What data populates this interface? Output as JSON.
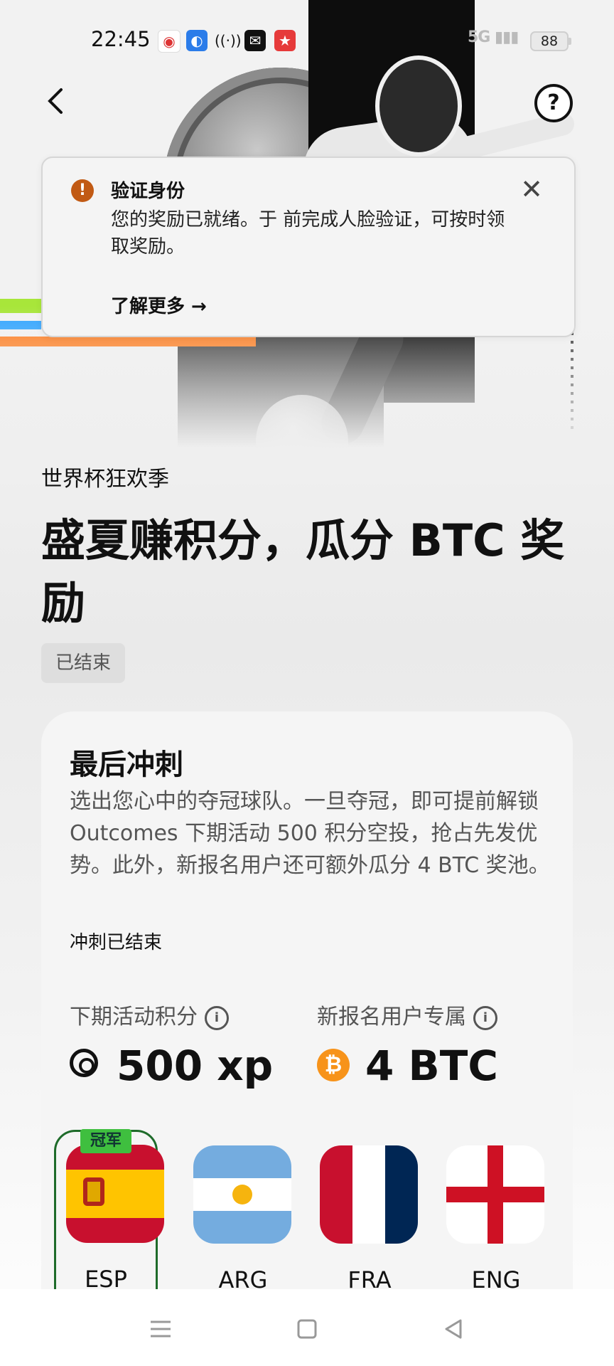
{
  "status_bar": {
    "time": "22:45",
    "network": "5G",
    "battery": "88"
  },
  "banner": {
    "title": "验证身份",
    "body": "您的奖励已就绪。于  前完成人脸验证，可按时领取奖励。",
    "link": "了解更多 →"
  },
  "event": {
    "label": "世界杯狂欢季",
    "title": "盛夏赚积分，瓜分 BTC 奖励",
    "status_tag": "已结束"
  },
  "card": {
    "title": "最后冲刺",
    "description": "选出您心中的夺冠球队。一旦夺冠，即可提前解锁 Outcomes 下期活动 500 积分空投，抢占先发优势。此外，新报名用户还可额外瓜分 4 BTC 奖池。",
    "status": "冲刺已结束",
    "stats": [
      {
        "label": "下期活动积分",
        "value": "500 xp",
        "icon": "xp-icon"
      },
      {
        "label": "新报名用户专属",
        "value": "4 BTC",
        "icon": "bitcoin-icon"
      }
    ],
    "teams": [
      {
        "code": "ESP",
        "badge": "冠军",
        "selected": true
      },
      {
        "code": "ARG"
      },
      {
        "code": "FRA"
      },
      {
        "code": "ENG"
      }
    ]
  },
  "colors": {
    "btc": "#f7931a",
    "warning": "#c15a14",
    "winner_border": "#1e6b2a",
    "winner_badge": "#3fbf3f"
  }
}
